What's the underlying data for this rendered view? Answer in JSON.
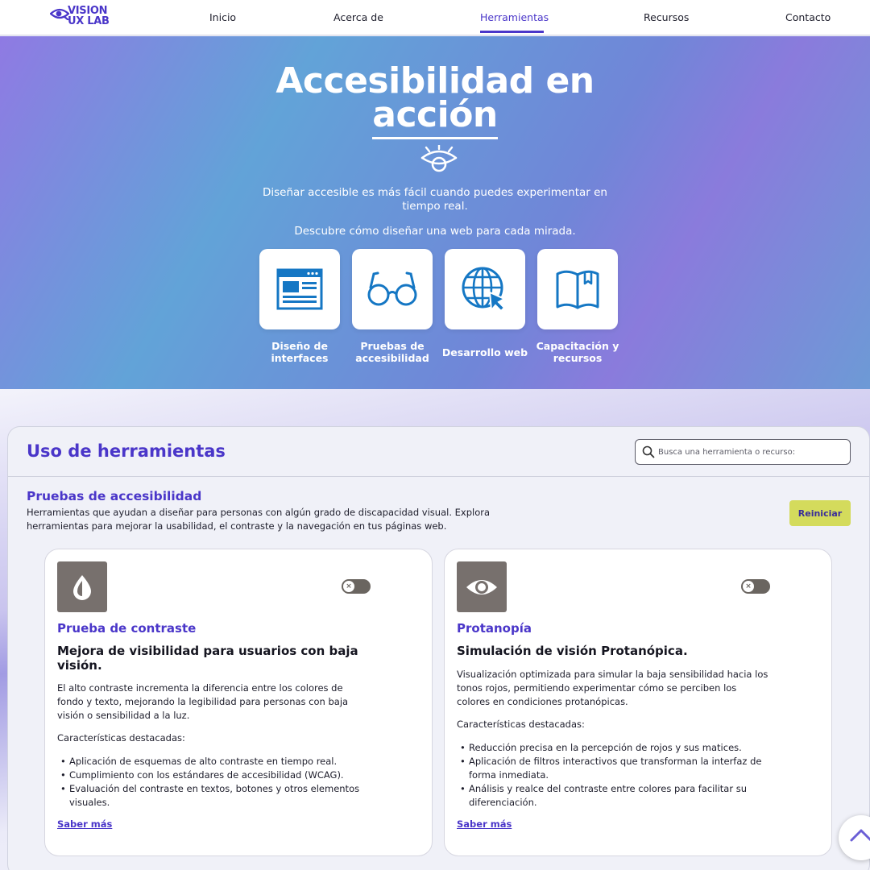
{
  "brand": {
    "line1": "VISION",
    "line2": "UX LAB"
  },
  "nav": {
    "items": [
      {
        "label": "Inicio"
      },
      {
        "label": "Acerca de"
      },
      {
        "label": "Herramientas",
        "active": true
      },
      {
        "label": "Recursos"
      },
      {
        "label": "Contacto"
      }
    ]
  },
  "hero": {
    "title_line1": "Accesibilidad en",
    "title_line2": "acción",
    "subtitle": "Diseñar accesible es más fácil cuando puedes experimentar en tiempo real.",
    "tagline": "Descubre cómo diseñar una web para cada mirada.",
    "categories": [
      {
        "label": "Diseño de interfaces",
        "icon": "browser-window-icon"
      },
      {
        "label": "Pruebas de accesibilidad",
        "icon": "glasses-icon"
      },
      {
        "label": "Desarrollo web",
        "icon": "globe-cursor-icon"
      },
      {
        "label": "Capacitación y recursos",
        "icon": "book-icon"
      }
    ]
  },
  "tools": {
    "title": "Uso de herramientas",
    "search_placeholder": "Busca una herramienta o recurso:",
    "section_title": "Pruebas de accesibilidad",
    "section_description": "Herramientas que ayudan a diseñar para personas con algún grado de discapacidad visual. Explora herramientas para mejorar la usabilidad, el contraste y la navegación en tus páginas web.",
    "reset_label": "Reiniciar",
    "cards": [
      {
        "icon": "drop-icon",
        "title": "Prueba de contraste",
        "subtitle": "Mejora de visibilidad para usuarios con baja visión.",
        "description": "El alto contraste incrementa la diferencia entre los colores de fondo y texto, mejorando la legibilidad para personas con baja visión o sensibilidad a la luz.",
        "features_label": "Características destacadas:",
        "features": [
          "Aplicación de esquemas de alto contraste en tiempo real.",
          "Cumplimiento con los estándares de accesibilidad (WCAG).",
          "Evaluación del contraste en textos, botones y otros elementos visuales."
        ],
        "link": "Saber más",
        "toggle_on": false
      },
      {
        "icon": "eye-icon",
        "title": "Protanopía",
        "subtitle": "Simulación de visión Protanópica.",
        "description": "Visualización optimizada para simular la baja sensibilidad hacia los tonos rojos, permitiendo experimentar cómo se perciben los colores en condiciones protanópicas.",
        "features_label": "Características destacadas:",
        "features": [
          "Reducción precisa en la percepción de rojos y sus matices.",
          "Aplicación de filtros interactivos que transforman la interfaz de forma inmediata.",
          "Análisis y realce del contraste entre colores para facilitar su diferenciación."
        ],
        "link": "Saber más",
        "toggle_on": false
      }
    ]
  },
  "colors": {
    "accent": "#4a36c9",
    "icon_blue": "#1577c4",
    "reset": "#d4db5c",
    "tile": "#77706d"
  }
}
